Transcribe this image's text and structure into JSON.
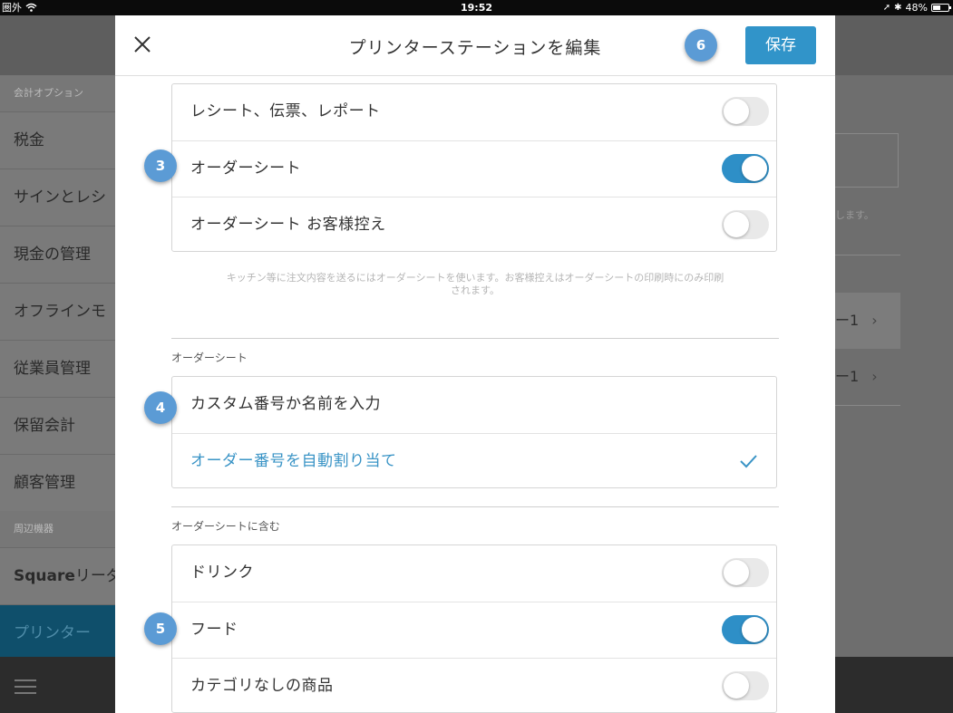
{
  "status_bar": {
    "carrier": "圏外",
    "time": "19:52",
    "battery": "48%",
    "battery_level": 0.48
  },
  "background": {
    "sidebar": {
      "section1": "会計オプション",
      "items": [
        "税金",
        "サインとレシ",
        "現金の管理",
        "オフラインモ",
        "従業員管理",
        "保留会計",
        "顧客管理"
      ],
      "section2": "周辺機器",
      "items2": [
        {
          "strong": "Square",
          "rest": "リーダ"
        },
        {
          "label": "プリンター"
        }
      ]
    },
    "right": {
      "hint": "します。",
      "row1": "ー1",
      "row2": "ー1"
    }
  },
  "modal": {
    "title": "プリンターステーションを編集",
    "save_label": "保存",
    "print_group": [
      {
        "label": "レシート、伝票、レポート",
        "on": false
      },
      {
        "label": "オーダーシート",
        "on": true
      },
      {
        "label": "オーダーシート お客様控え",
        "on": false
      }
    ],
    "print_note_line1": "キッチン等に注文内容を送るにはオーダーシートを使います。お客様控えはオーダーシートの印刷時にのみ印刷",
    "print_note_line2": "されます。",
    "order_sheet_section": "オーダーシート",
    "order_options": [
      {
        "label": "カスタム番号か名前を入力",
        "selected": false
      },
      {
        "label": "オーダー番号を自動割り当て",
        "selected": true
      }
    ],
    "include_section": "オーダーシートに含む",
    "include_group": [
      {
        "label": "ドリンク",
        "on": false
      },
      {
        "label": "フード",
        "on": true
      },
      {
        "label": "カテゴリなしの商品",
        "on": false
      }
    ],
    "badges": {
      "print": "3",
      "order": "4",
      "include": "5",
      "save": "6"
    }
  },
  "colors": {
    "accent": "#2e8fc7",
    "badge": "#5b9bd5",
    "selected_text": "#3a94c6"
  }
}
